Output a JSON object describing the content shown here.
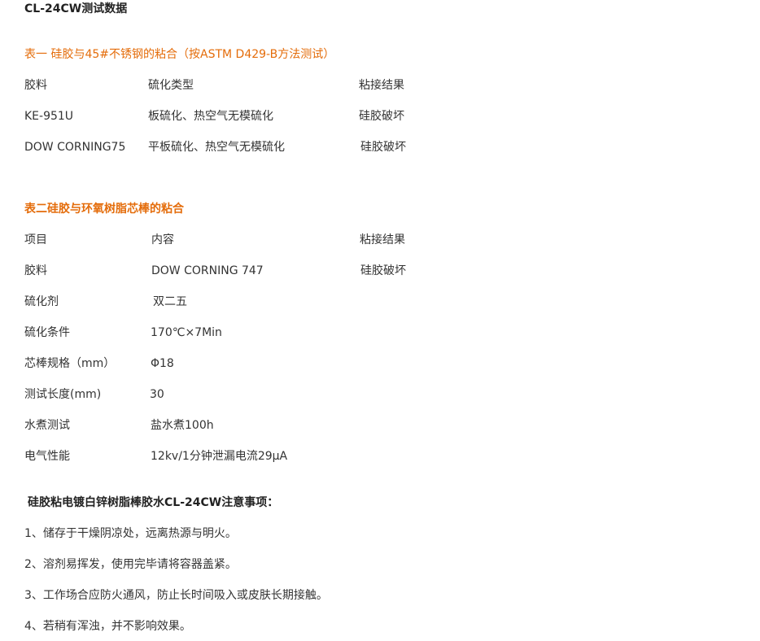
{
  "title": "CL-24CW测试数据",
  "table1": {
    "caption": "表一 硅胶与45#不锈钢的粘合（按ASTM D429-B方法测试）",
    "headers": [
      "胶料",
      "硫化类型",
      "粘接结果"
    ],
    "rows": [
      [
        "KE-951U",
        "板硫化、热空气无模硫化",
        "硅胶破坏"
      ],
      [
        "DOW CORNING75",
        "平板硫化、热空气无模硫化",
        "硅胶破坏"
      ]
    ]
  },
  "table2": {
    "caption": "表二硅胶与环氧树脂芯棒的粘合",
    "headers": [
      "项目",
      "内容",
      "粘接结果"
    ],
    "rows": [
      [
        "胶料",
        "DOW CORNING 747",
        "硅胶破坏"
      ],
      [
        "硫化剂",
        "双二五",
        ""
      ],
      [
        "硫化条件",
        "170℃×7Min",
        ""
      ],
      [
        "芯棒规格（mm）",
        "Φ18",
        ""
      ],
      [
        "测试长度(mm)",
        "30",
        ""
      ],
      [
        "水煮测试",
        "盐水煮100h",
        ""
      ],
      [
        "电气性能",
        "12kv/1分钟泄漏电流29μA",
        ""
      ]
    ]
  },
  "notes": {
    "heading": "硅胶粘电镀白锌树脂棒胶水CL-24CW注意事项：",
    "items": [
      "1、储存于干燥阴凉处，远离热源与明火。",
      "2、溶剂易挥发，使用完毕请将容器盖紧。",
      "3、工作场合应防火通风，防止长时间吸入或皮肤长期接触。",
      "4、若稍有浑浊，并不影响效果。"
    ]
  },
  "colors": {
    "accent": "#e46c0a",
    "text": "#333333"
  }
}
